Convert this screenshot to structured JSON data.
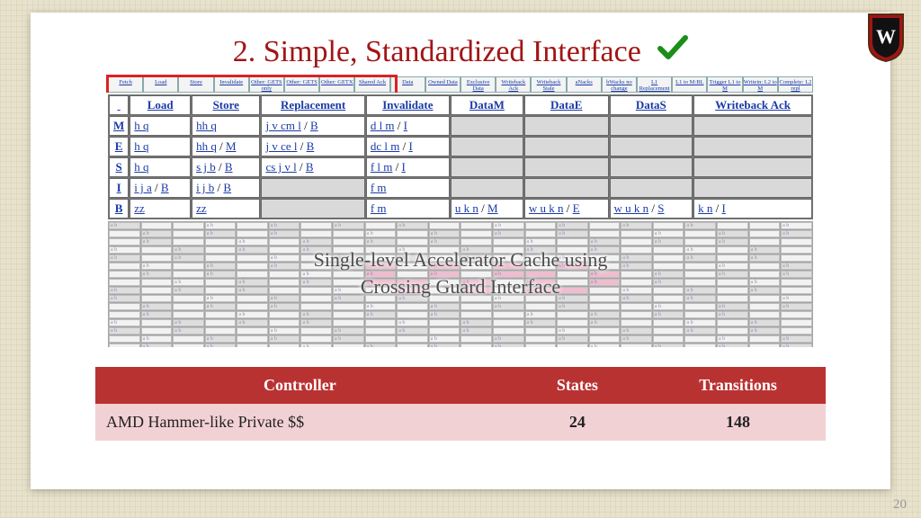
{
  "page_number": "20",
  "title": "2. Simple, Standardized Interface",
  "top_strip": [
    "Fetch",
    "Load",
    "Store",
    "Invalidate",
    "Other: GETS only",
    "Other: GETS",
    "Other: GETX",
    "Shared Ack",
    "Data",
    "Owned Data",
    "Exclusive Data",
    "Writeback Ack",
    "Writeback Stale",
    "aNacks",
    "bWacks no change",
    "L1 Replacement",
    "L1 to M:BL",
    "Trigger L1 to M",
    "Writein: L2 to M",
    "Complete: L2 repl"
  ],
  "columns": [
    "",
    "Load",
    "Store",
    "Replacement",
    "Invalidate",
    "DataM",
    "DataE",
    "DataS",
    "Writeback Ack"
  ],
  "rows": [
    {
      "hdr": "M",
      "cells": [
        "h q",
        "hh q",
        "j v cm l / B",
        "d l m / I",
        "",
        "",
        "",
        ""
      ]
    },
    {
      "hdr": "E",
      "cells": [
        "h q",
        "hh q / M",
        "j v ce l / B",
        "dc l m / I",
        "",
        "",
        "",
        ""
      ]
    },
    {
      "hdr": "S",
      "cells": [
        "h q",
        "s j b / B",
        "cs j v l / B",
        "f l m / I",
        "",
        "",
        "",
        ""
      ]
    },
    {
      "hdr": "I",
      "cells": [
        "i j a / B",
        "i j b / B",
        "",
        "f m",
        "",
        "",
        "",
        ""
      ]
    },
    {
      "hdr": "B",
      "cells": [
        "zz",
        "zz",
        "",
        "f m",
        "u k n / M",
        "w u k n / E",
        "w u k n / S",
        "k n / I"
      ]
    }
  ],
  "overlay_line1": "Single-level Accelerator Cache using",
  "overlay_line2": "Crossing Guard Interface",
  "summary": {
    "headers": [
      "Controller",
      "States",
      "Transitions"
    ],
    "row": {
      "controller": "AMD Hammer-like Private $$",
      "states": "24",
      "transitions": "148"
    }
  },
  "chart_data": {
    "type": "table",
    "title": "Controller complexity",
    "columns": [
      "Controller",
      "States",
      "Transitions"
    ],
    "rows": [
      [
        "AMD Hammer-like Private $$",
        24,
        148
      ]
    ]
  }
}
